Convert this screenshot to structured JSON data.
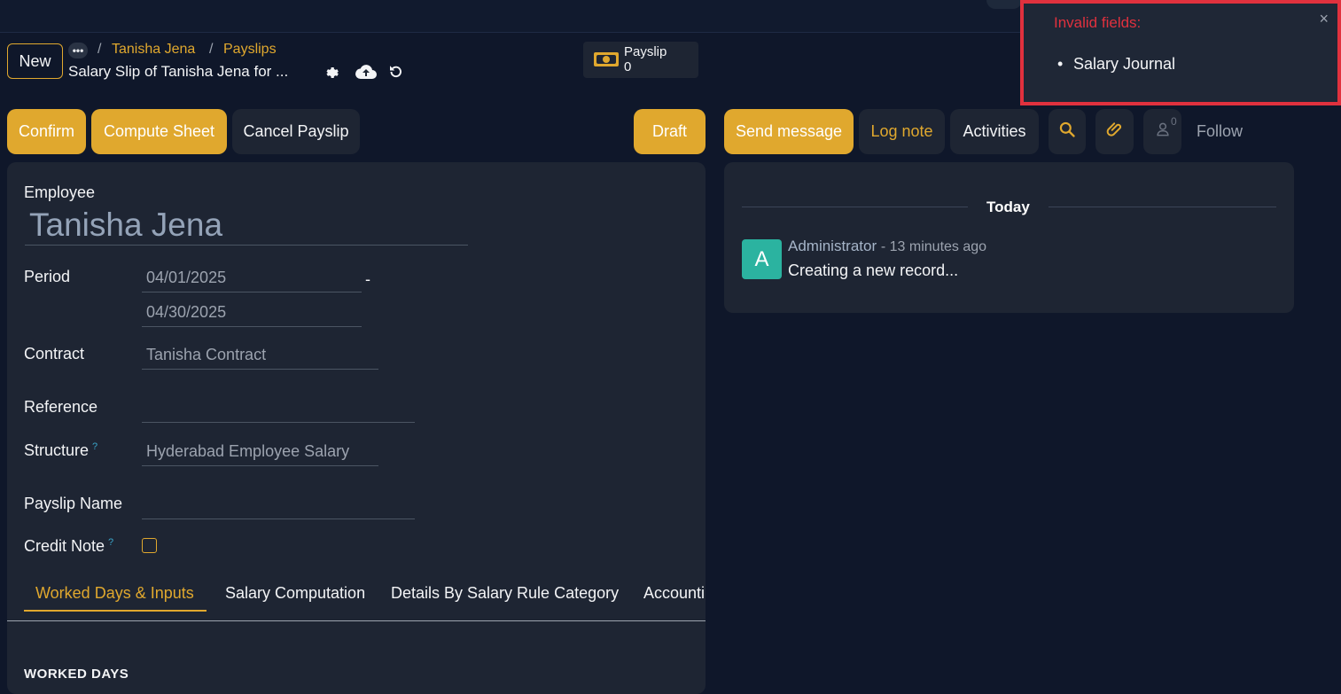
{
  "control_panel": {
    "new_label": "New",
    "breadcrumbs": [
      {
        "label": "Tanisha Jena"
      },
      {
        "label": "Payslips"
      }
    ],
    "record_title": "Salary Slip of Tanisha Jena for ...",
    "smart_button": {
      "label": "Payslip",
      "count": "0"
    }
  },
  "notification": {
    "title": "Invalid fields:",
    "items": [
      "Salary Journal"
    ],
    "close": "×"
  },
  "actions": {
    "confirm": "Confirm",
    "compute_sheet": "Compute Sheet",
    "cancel_payslip": "Cancel Payslip",
    "status": "Draft"
  },
  "form": {
    "employee_label": "Employee",
    "employee_value": "Tanisha Jena",
    "period_label": "Period",
    "period_from": "04/01/2025",
    "period_sep": "-",
    "period_to": "04/30/2025",
    "contract_label": "Contract",
    "contract_value": "Tanisha Contract",
    "reference_label": "Reference",
    "reference_value": "",
    "structure_label": "Structure",
    "structure_value": "Hyderabad Employee Salary",
    "payslip_name_label": "Payslip Name",
    "payslip_name_value": "",
    "credit_note_label": "Credit Note",
    "help_mark": "?",
    "tabs": [
      "Worked Days & Inputs",
      "Salary Computation",
      "Details By Salary Rule Category",
      "Accounting"
    ],
    "active_tab": "Worked Days & Inputs",
    "section_heading": "WORKED DAYS"
  },
  "chatter": {
    "send_message": "Send message",
    "log_note": "Log note",
    "activities": "Activities",
    "follower_count": "0",
    "follow": "Follow",
    "date_separator": "Today",
    "message": {
      "avatar_letter": "A",
      "author": "Administrator",
      "time": "- 13 minutes ago",
      "body": "Creating a new record..."
    }
  },
  "colors": {
    "accent": "#e0a82e",
    "background": "#0f172a",
    "panel": "#1e2533",
    "error": "#e0313e",
    "avatar": "#2bb3a0"
  }
}
